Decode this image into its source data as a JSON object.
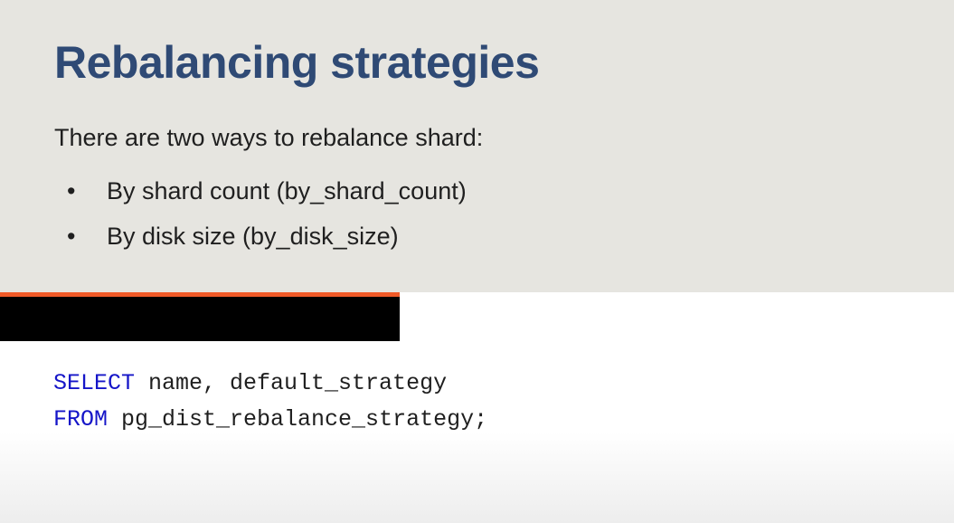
{
  "slide": {
    "title": "Rebalancing strategies",
    "intro": "There are two ways to rebalance shard:",
    "bullets": [
      {
        "marker": "•",
        "text": "By shard count (by_shard_count)"
      },
      {
        "marker": "•",
        "text": "By disk size (by_disk_size)"
      }
    ],
    "code": {
      "line1_keyword": "SELECT",
      "line1_rest": " name, default_strategy",
      "line2_keyword": "FROM",
      "line2_rest": " pg_dist_rebalance_strategy;"
    }
  },
  "colors": {
    "background_top": "#e6e5e0",
    "title": "#2f4a75",
    "accent": "#f05a28",
    "redaction": "#000000",
    "sql_keyword": "#1515c8"
  }
}
